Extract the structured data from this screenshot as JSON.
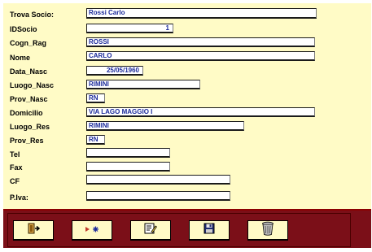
{
  "form": {
    "fields": [
      {
        "key": "trova_socio",
        "label": "Trova Socio:",
        "value": "Rossi  Carlo",
        "placeholder": ""
      },
      {
        "key": "id_socio",
        "label": "IDSocio",
        "value": "1",
        "placeholder": ""
      },
      {
        "key": "cogn_rag",
        "label": "Cogn_Rag",
        "value": "ROSSI",
        "placeholder": ""
      },
      {
        "key": "nome",
        "label": "Nome",
        "value": "CARLO",
        "placeholder": ""
      },
      {
        "key": "data_nasc",
        "label": "Data_Nasc",
        "value": "25/05/1960",
        "placeholder": ""
      },
      {
        "key": "luogo_nasc",
        "label": "Luogo_Nasc",
        "value": "RIMINI",
        "placeholder": ""
      },
      {
        "key": "prov_nasc",
        "label": "Prov_Nasc",
        "value": "RN",
        "placeholder": ""
      },
      {
        "key": "domicilio",
        "label": "Domicilio",
        "value": "VIA LAGO MAGGIO I",
        "placeholder": ""
      },
      {
        "key": "luogo_res",
        "label": "Luogo_Res",
        "value": "RIMINI",
        "placeholder": ""
      },
      {
        "key": "prov_res",
        "label": "Prov_Res",
        "value": "RN",
        "placeholder": ""
      },
      {
        "key": "tel",
        "label": "Tel",
        "value": "",
        "placeholder": ""
      },
      {
        "key": "fax",
        "label": "Fax",
        "value": "",
        "placeholder": ""
      },
      {
        "key": "cf",
        "label": "CF",
        "value": "",
        "placeholder": ""
      },
      {
        "key": "piva",
        "label": "P.Iva:",
        "value": "",
        "placeholder": ""
      }
    ]
  },
  "toolbar": {
    "buttons": [
      {
        "icon": "exit-door-icon"
      },
      {
        "icon": "new-record-icon"
      },
      {
        "icon": "edit-record-icon"
      },
      {
        "icon": "save-disk-icon"
      },
      {
        "icon": "trash-bin-icon"
      }
    ]
  },
  "colors": {
    "form_background": "#fffbc6",
    "toolbar_background": "#7b0f18",
    "field_text": "#1b2a9a"
  }
}
